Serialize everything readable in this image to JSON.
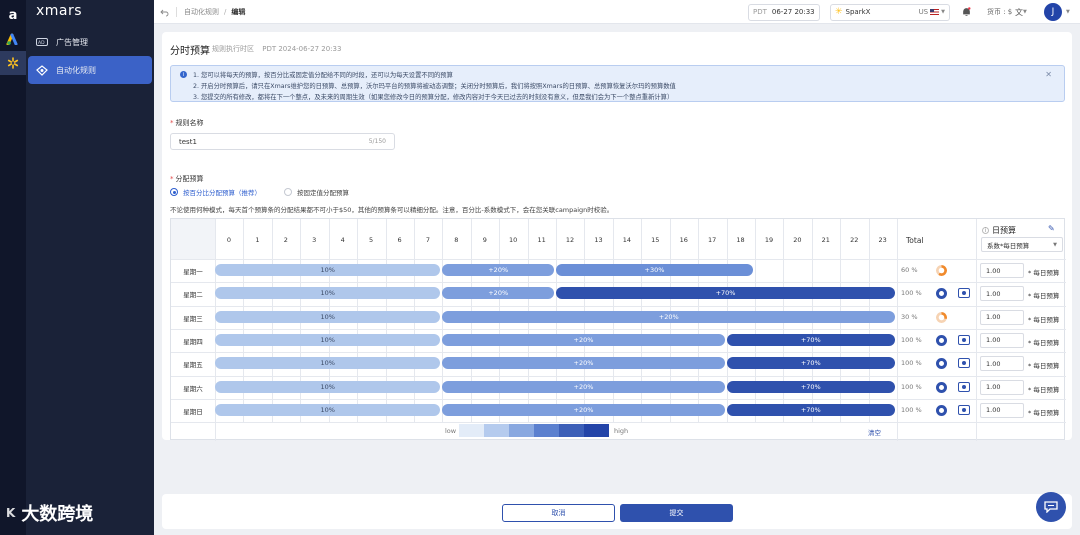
{
  "rail": {
    "logo": "a"
  },
  "nav": {
    "brand": "xmars",
    "items": [
      {
        "label": "广告管理",
        "active": false
      },
      {
        "label": "自动化规则",
        "active": true
      }
    ]
  },
  "topbar": {
    "breadcrumb": [
      "自动化规则",
      "编辑"
    ],
    "timezone": "PDT",
    "time": "06-27 20:33",
    "market_name": "SparkX",
    "market_region": "US",
    "currency_label": "货币 : $",
    "avatar": "J"
  },
  "page": {
    "title": "分时预算",
    "timezone_note": "规则执行时区",
    "timezone_value": "PDT 2024-06-27 20:33",
    "notice_lines": [
      "1. 您可以将每天的预算，按百分比或固定值分配给不同的时段，还可以为每天设置不同的预算",
      "2. 开启分时预算后，请只在Xmars维护您的日预算、总预算，沃尔玛平台的预算将被动态调整；关闭分时预算后，我们将按照Xmars的日预算、总预算恢复沃尔玛的预算数值",
      "3. 您提交的所有修改，都将在下一个整点，及未来的周期生效（如果您修改今日的预算分配，修改内容对于今天已过去的时刻没有意义，但是我们会为下一个整点重新计算）"
    ],
    "rule_name_label": "规则名称",
    "rule_name_value": "test1",
    "rule_name_count": "5/150",
    "alloc_label": "分配预算",
    "radio_percent": "按百分比分配预算（推荐）",
    "radio_fixed": "按固定值分配预算",
    "alloc_desc": "不论使用何种模式，每天首个预算条的分配结果都不可小于$50，其他的预算条可以精细分配。注意，百分比-系数模式下，会在您关联campaign时校验。"
  },
  "schedule": {
    "hours": [
      "0",
      "1",
      "2",
      "3",
      "4",
      "5",
      "6",
      "7",
      "8",
      "9",
      "10",
      "11",
      "12",
      "13",
      "14",
      "15",
      "16",
      "17",
      "18",
      "19",
      "20",
      "21",
      "22",
      "23"
    ],
    "total_header": "Total",
    "budget_header": "日预算",
    "budget_select": "系数*每日预算",
    "days": [
      {
        "label": "星期一",
        "total": "60 %",
        "complete": false,
        "fill": 0.6,
        "budget": "1.00",
        "budget_suffix": "* 每日预算",
        "segments": [
          {
            "start": 0,
            "end": 8,
            "label": "10%",
            "level": 1
          },
          {
            "start": 8,
            "end": 12,
            "label": "+20%",
            "level": 2
          },
          {
            "start": 12,
            "end": 19,
            "label": "+30%",
            "level": 3
          }
        ]
      },
      {
        "label": "星期二",
        "total": "100 %",
        "complete": true,
        "fill": 1,
        "budget": "1.00",
        "budget_suffix": "* 每日预算",
        "segments": [
          {
            "start": 0,
            "end": 8,
            "label": "10%",
            "level": 1
          },
          {
            "start": 8,
            "end": 12,
            "label": "+20%",
            "level": 2
          },
          {
            "start": 12,
            "end": 24,
            "label": "+70%",
            "level": 4
          }
        ]
      },
      {
        "label": "星期三",
        "total": "30 %",
        "complete": false,
        "fill": 0.3,
        "budget": "1.00",
        "budget_suffix": "* 每日预算",
        "segments": [
          {
            "start": 0,
            "end": 8,
            "label": "10%",
            "level": 1
          },
          {
            "start": 8,
            "end": 24,
            "label": "+20%",
            "level": 2
          }
        ]
      },
      {
        "label": "星期四",
        "total": "100 %",
        "complete": true,
        "fill": 1,
        "budget": "1.00",
        "budget_suffix": "* 每日预算",
        "segments": [
          {
            "start": 0,
            "end": 8,
            "label": "10%",
            "level": 1
          },
          {
            "start": 8,
            "end": 18,
            "label": "+20%",
            "level": 2
          },
          {
            "start": 18,
            "end": 24,
            "label": "+70%",
            "level": 4
          }
        ]
      },
      {
        "label": "星期五",
        "total": "100 %",
        "complete": true,
        "fill": 1,
        "budget": "1.00",
        "budget_suffix": "* 每日预算",
        "segments": [
          {
            "start": 0,
            "end": 8,
            "label": "10%",
            "level": 1
          },
          {
            "start": 8,
            "end": 18,
            "label": "+20%",
            "level": 2
          },
          {
            "start": 18,
            "end": 24,
            "label": "+70%",
            "level": 4
          }
        ]
      },
      {
        "label": "星期六",
        "total": "100 %",
        "complete": true,
        "fill": 1,
        "budget": "1.00",
        "budget_suffix": "* 每日预算",
        "segments": [
          {
            "start": 0,
            "end": 8,
            "label": "10%",
            "level": 1
          },
          {
            "start": 8,
            "end": 18,
            "label": "+20%",
            "level": 2
          },
          {
            "start": 18,
            "end": 24,
            "label": "+70%",
            "level": 4
          }
        ]
      },
      {
        "label": "星期日",
        "total": "100 %",
        "complete": true,
        "fill": 1,
        "budget": "1.00",
        "budget_suffix": "* 每日预算",
        "segments": [
          {
            "start": 0,
            "end": 8,
            "label": "10%",
            "level": 1
          },
          {
            "start": 8,
            "end": 18,
            "label": "+20%",
            "level": 2
          },
          {
            "start": 18,
            "end": 24,
            "label": "+70%",
            "level": 4
          }
        ]
      }
    ],
    "legend_low": "low",
    "legend_high": "high",
    "legend_colors": [
      "#e3ecf8",
      "#b5cbee",
      "#89a8e0",
      "#5b80cf",
      "#3c5fb8",
      "#2344a8"
    ],
    "clear_label": "清空"
  },
  "footer": {
    "cancel": "取消",
    "submit": "提交"
  },
  "watermark": "大数跨境",
  "colors": {
    "primary": "#2f51ad",
    "nav_bg": "#1a2238",
    "nav_active": "#3b62c7",
    "partial_ring": "#f08a2c"
  }
}
